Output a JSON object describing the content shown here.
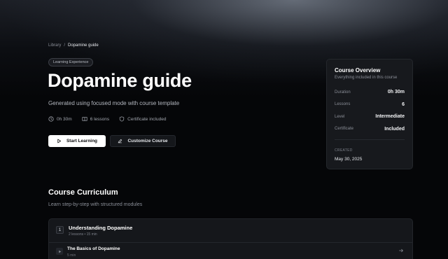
{
  "breadcrumb": {
    "root": "Library",
    "separator": "/",
    "current": "Dopamine guide"
  },
  "tag": "Learning Experience",
  "title": "Dopamine guide",
  "subtitle": "Generated using focused mode with course template",
  "meta": {
    "duration": "0h 30m",
    "lessons": "6 lessons",
    "certificate": "Certificate included"
  },
  "actions": {
    "start": "Start Learning",
    "customize": "Customize Course"
  },
  "overview": {
    "title": "Course Overview",
    "subtitle": "Everything included in this course",
    "rows": [
      {
        "label": "Duration",
        "value": "0h 30m"
      },
      {
        "label": "Lessons",
        "value": "6"
      },
      {
        "label": "Level",
        "value": "Intermediate"
      },
      {
        "label": "Certificate",
        "value": "Included"
      }
    ],
    "created_label": "CREATED",
    "created_date": "May 30, 2025"
  },
  "curriculum": {
    "title": "Course Curriculum",
    "subtitle": "Learn step-by-step with structured modules",
    "modules": [
      {
        "number": "1",
        "title": "Understanding Dopamine",
        "meta": "2 lessons • 15 min",
        "lessons": [
          {
            "title": "The Basics of Dopamine",
            "duration": "5 min"
          }
        ]
      }
    ]
  },
  "colors": {
    "background": "#050608",
    "card": "#17191d",
    "primary_button": "#ffffff",
    "accent_text": "#ffffff",
    "muted_text": "#8b8f98"
  },
  "icons": {
    "duration": "clock-icon",
    "lessons": "book-icon",
    "certificate": "shield-icon",
    "start": "play-icon",
    "customize": "pencil-icon",
    "lesson": "play-icon",
    "lesson_open": "arrow-right-icon"
  }
}
